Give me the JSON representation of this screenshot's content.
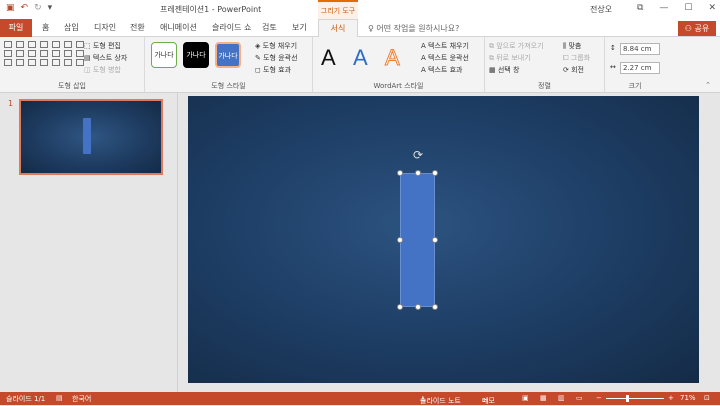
{
  "titlebar": {
    "doc_title": "프레젠테이션1 - PowerPoint",
    "contextual_tab_title": "그리기 도구",
    "user_name": "전상오",
    "qat_icons": [
      "save-icon",
      "undo-icon",
      "redo-icon",
      "customize-icon"
    ]
  },
  "tabs": {
    "file": "파일",
    "items": [
      "홈",
      "삽입",
      "디자인",
      "전환",
      "애니메이션",
      "슬라이드 쇼",
      "검토",
      "보기"
    ],
    "active": "서식",
    "tell_me": "어떤 작업을 원하시나요?",
    "share": "공유"
  },
  "ribbon": {
    "insert_shapes": {
      "label": "도형 삽입",
      "edit_shape": "도형 편집",
      "text_box": "텍스트 상자",
      "merge_shapes": "도형 병합"
    },
    "shape_styles": {
      "label": "도형 스타일",
      "samples": [
        "가나다",
        "가나다",
        "가나다"
      ],
      "fill": "도형 채우기",
      "outline": "도형 윤곽선",
      "effects": "도형 효과"
    },
    "wordart": {
      "label": "WordArt 스타일",
      "samples": [
        "A",
        "A",
        "A"
      ],
      "text_fill": "텍스트 채우기",
      "text_outline": "텍스트 윤곽선",
      "text_effects": "텍스트 효과"
    },
    "arrange": {
      "label": "정렬",
      "bring_forward": "앞으로 가져오기",
      "send_backward": "뒤로 보내기",
      "selection_pane": "선택 창",
      "align": "맞춤",
      "group": "그룹화",
      "rotate": "회전"
    },
    "size": {
      "label": "크기",
      "height": "8.84 cm",
      "width": "2.27 cm"
    }
  },
  "thumbs": {
    "slide_number": "1"
  },
  "statusbar": {
    "slide_info": "슬라이드 1/1",
    "language": "한국어",
    "notes": "슬라이드 노트",
    "comments": "메모",
    "zoom": "71%"
  },
  "colors": {
    "accent": "#c5492b",
    "shape_fill": "#4472c4",
    "slide_bg": "#1f4068"
  }
}
